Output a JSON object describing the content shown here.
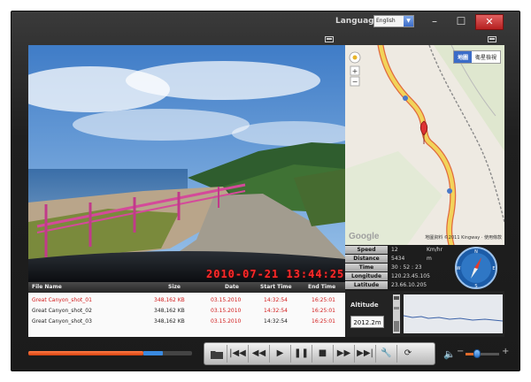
{
  "window": {
    "language_label": "Language",
    "language_value": "English",
    "minimize_glyph": "–",
    "maximize_glyph": "☐",
    "close_glyph": "✕"
  },
  "video": {
    "timestamp": "2010-07-21 13:44:25"
  },
  "map": {
    "tabs": [
      "地圖",
      "衛星檢視"
    ],
    "active_tab": "地圖",
    "google_label": "Google",
    "copyright": "地圖資料 ©2011 Kingway · 使用條款"
  },
  "stats": [
    {
      "label": "Speed",
      "value": "12",
      "unit": "Km/hr"
    },
    {
      "label": "Distance",
      "value": "5434",
      "unit": "m"
    },
    {
      "label": "Time",
      "value": "30 : 52 : 23",
      "unit": ""
    },
    {
      "label": "Longitude",
      "value": "120.23.45.105",
      "unit": ""
    },
    {
      "label": "Latitude",
      "value": "23.66.10.205",
      "unit": ""
    }
  ],
  "altitude": {
    "label": "Altitude",
    "value": "2012.2m"
  },
  "file_table": {
    "headers": [
      "File Name",
      "Size",
      "Date",
      "Start Time",
      "End Time"
    ],
    "rows": [
      {
        "name": "Great Canyon_shot_01",
        "size": "348,162 KB",
        "date": "03.15.2010",
        "start": "14:32:54",
        "end": "16:25:01",
        "selected": true
      },
      {
        "name": "Great Canyon_shot_02",
        "size": "348,162 KB",
        "date": "03.15.2010",
        "start": "14:32:54",
        "end": "16:25:01",
        "selected": false
      },
      {
        "name": "Great Canyon_shot_03",
        "size": "348,162 KB",
        "date": "03.15.2010",
        "start": "14:32:54",
        "end": "16:25:01",
        "selected": false
      }
    ]
  },
  "playback": {
    "progress": 0.7,
    "volume": 0.35
  },
  "colors": {
    "accent": "#e05a24",
    "timestamp": "#ff2a2a",
    "selected_row": "#d21c1c",
    "map_route": "#f2d35a",
    "map_route_outline": "#e06a3f"
  },
  "icons": {
    "open": "folder-icon",
    "prev": "skip-back-icon",
    "rewind": "rewind-icon",
    "play": "play-icon",
    "pause": "pause-icon",
    "stop": "stop-icon",
    "forward": "fast-forward-icon",
    "next": "skip-forward-icon",
    "settings": "wrench-icon",
    "repeat": "repeat-icon",
    "volume": "speaker-icon"
  }
}
